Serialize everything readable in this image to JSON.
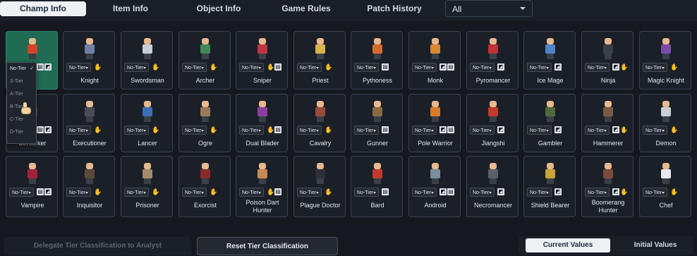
{
  "tabs": [
    {
      "label": "Champ Info",
      "active": true
    },
    {
      "label": "Item Info",
      "active": false
    },
    {
      "label": "Object Info",
      "active": false
    },
    {
      "label": "Game Rules",
      "active": false
    },
    {
      "label": "Patch History",
      "active": false
    }
  ],
  "filter": {
    "selected": "All"
  },
  "tier_options": [
    "No-Tier",
    "S-Tier",
    "A-Tier",
    "B-Tier",
    "C-Tier",
    "D-Tier"
  ],
  "champions": [
    {
      "name": "",
      "tier": "No-Tier",
      "color": "#d2452a",
      "selected": true
    },
    {
      "name": "Knight",
      "tier": "No-Tier",
      "color": "#6e7fa8"
    },
    {
      "name": "Swordsman",
      "tier": "No-Tier",
      "color": "#c9cfd6"
    },
    {
      "name": "Archer",
      "tier": "No-Tier",
      "color": "#3f8a57"
    },
    {
      "name": "Sniper",
      "tier": "No-Tier",
      "color": "#c33447"
    },
    {
      "name": "Priest",
      "tier": "No-Tier",
      "color": "#d9b44a"
    },
    {
      "name": "Pythoness",
      "tier": "No-Tier",
      "color": "#d46a2d"
    },
    {
      "name": "Monk",
      "tier": "No-Tier",
      "color": "#d98a30"
    },
    {
      "name": "Pyromancer",
      "tier": "No-Tier",
      "color": "#c2303a"
    },
    {
      "name": "Ice Mage",
      "tier": "No-Tier",
      "color": "#4e84c9"
    },
    {
      "name": "Ninja",
      "tier": "No-Tier",
      "color": "#3a3f4a"
    },
    {
      "name": "Magic Knight",
      "tier": "No-Tier",
      "color": "#7b4ba8"
    },
    {
      "name": "Berserker",
      "tier": "No-Tier",
      "color": "#7a5b3d"
    },
    {
      "name": "Executioner",
      "tier": "No-Tier",
      "color": "#4a4d55"
    },
    {
      "name": "Lancer",
      "tier": "No-Tier",
      "color": "#3a6fb8"
    },
    {
      "name": "Ogre",
      "tier": "No-Tier",
      "color": "#9a7a58"
    },
    {
      "name": "Dual Blader",
      "tier": "No-Tier",
      "color": "#8b3fa0"
    },
    {
      "name": "Cavalry",
      "tier": "No-Tier",
      "color": "#9b4a3a"
    },
    {
      "name": "Gunner",
      "tier": "No-Tier",
      "color": "#8a6a45"
    },
    {
      "name": "Pole Warrior",
      "tier": "No-Tier",
      "color": "#d97a2a"
    },
    {
      "name": "Jiangshi",
      "tier": "No-Tier",
      "color": "#c0392b"
    },
    {
      "name": "Gambler",
      "tier": "No-Tier",
      "color": "#4f6a3a"
    },
    {
      "name": "Hammerer",
      "tier": "No-Tier",
      "color": "#7a5a45"
    },
    {
      "name": "Demon",
      "tier": "No-Tier",
      "color": "#c9ced4"
    },
    {
      "name": "Vampire",
      "tier": "No-Tier",
      "color": "#a3203a"
    },
    {
      "name": "Inquisitor",
      "tier": "No-Tier",
      "color": "#5a4a3a"
    },
    {
      "name": "Prisoner",
      "tier": "No-Tier",
      "color": "#a58a6a"
    },
    {
      "name": "Exorcist",
      "tier": "No-Tier",
      "color": "#8a2a2a"
    },
    {
      "name": "Poison Dart Hunter",
      "tier": "No-Tier",
      "color": "#c78a55"
    },
    {
      "name": "Plague Doctor",
      "tier": "No-Tier",
      "color": "#2c2f36"
    },
    {
      "name": "Bard",
      "tier": "No-Tier",
      "color": "#c0392b"
    },
    {
      "name": "Android",
      "tier": "No-Tier",
      "color": "#7b8fa0"
    },
    {
      "name": "Necromancer",
      "tier": "No-Tier",
      "color": "#5a5f6a"
    },
    {
      "name": "Shield Bearer",
      "tier": "No-Tier",
      "color": "#c9a23a"
    },
    {
      "name": "Boomerang Hunter",
      "tier": "No-Tier",
      "color": "#7a4a3a"
    },
    {
      "name": "Chef",
      "tier": "No-Tier",
      "color": "#e6e9ee"
    }
  ],
  "footer": {
    "delegate_label": "Delegate Tier Classification to Analyst",
    "reset_label": "Reset Tier Classification",
    "current_values_label": "Current Values",
    "initial_values_label": "Initial Values"
  }
}
